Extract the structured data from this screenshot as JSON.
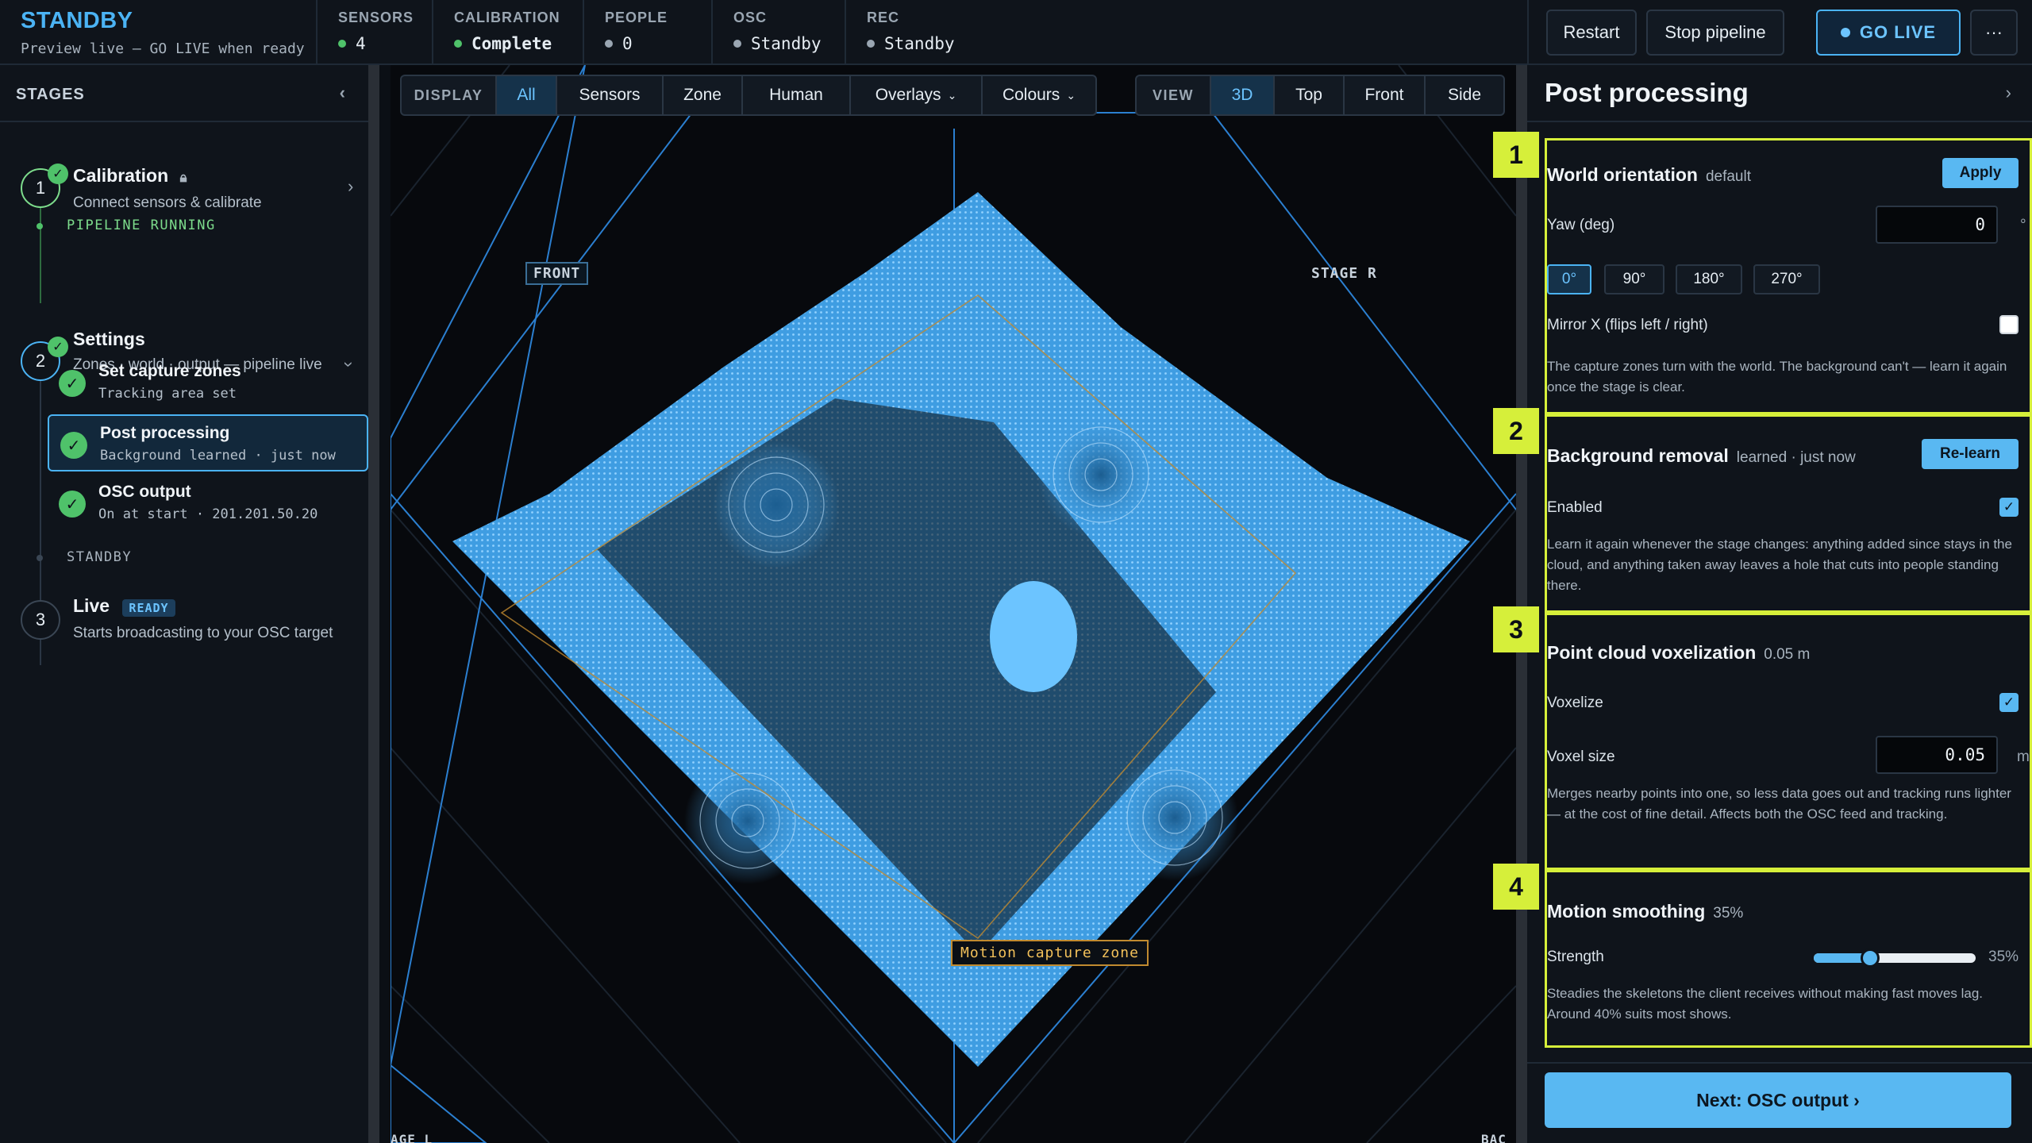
{
  "brand": {
    "title": "STANDBY",
    "subtitle": "Preview live — GO LIVE when ready"
  },
  "stats": [
    {
      "label": "SENSORS",
      "value": "4",
      "dot": "#4fc26a"
    },
    {
      "label": "CALIBRATION",
      "value": "Complete",
      "dot": "#4fc26a"
    },
    {
      "label": "PEOPLE",
      "value": "0",
      "dot": "#9aa6b2"
    },
    {
      "label": "OSC",
      "value": "Standby",
      "dot": "#9aa6b2"
    },
    {
      "label": "REC",
      "value": "Standby",
      "dot": "#9aa6b2"
    }
  ],
  "toolbar": {
    "restart": "Restart",
    "stop": "Stop pipeline",
    "golive": "GO LIVE",
    "more": "···"
  },
  "sidebar": {
    "header": "STAGES",
    "steps": [
      {
        "num": "1",
        "name": "Calibration",
        "desc": "Connect sensors & calibrate"
      },
      {
        "num": "2",
        "name": "Settings",
        "desc": "Zones · world · output — pipeline live"
      },
      {
        "num": "3",
        "name": "Live",
        "badge": "READY",
        "desc": "Starts broadcasting to your OSC target"
      }
    ],
    "pipeline_status": "PIPELINE RUNNING",
    "standby_status": "STANDBY",
    "subitems": [
      {
        "name": "Set capture zones",
        "desc": "Tracking area set"
      },
      {
        "name": "Post processing",
        "desc": "Background learned · just now"
      },
      {
        "name": "OSC output",
        "desc": "On at start · 201.201.50.20"
      }
    ]
  },
  "display": {
    "label": "DISPLAY",
    "options": [
      "All",
      "Sensors",
      "Zone",
      "Human",
      "Overlays",
      "Colours"
    ],
    "selected": "All"
  },
  "view": {
    "label": "VIEW",
    "options": [
      "3D",
      "Top",
      "Front",
      "Side"
    ],
    "selected": "3D"
  },
  "viewport": {
    "front_tag": "FRONT",
    "stage_tag": "STAGE R",
    "zone_label": "Motion capture zone",
    "stage_l": "AGE L",
    "back": "BAC"
  },
  "panel": {
    "title": "Post processing",
    "sections": [
      {
        "num": "1",
        "title": "World orientation",
        "meta": "default",
        "apply": "Apply",
        "yaw_label": "Yaw (deg)",
        "yaw_value": "0",
        "unit": "°",
        "presets": [
          "0°",
          "90°",
          "180°",
          "270°"
        ],
        "mirror_label": "Mirror X (flips left / right)",
        "help": "The capture zones turn with the world. The background can't — learn it again once the stage is clear."
      },
      {
        "num": "2",
        "title": "Background removal",
        "meta": "learned · just now",
        "action": "Re-learn",
        "enabled_label": "Enabled",
        "help": "Learn it again whenever the stage changes: anything added since stays in the cloud, and anything taken away leaves a hole that cuts into people standing there."
      },
      {
        "num": "3",
        "title": "Point cloud voxelization",
        "meta": "0.05 m",
        "voxelize_label": "Voxelize",
        "size_label": "Voxel size",
        "size_value": "0.05",
        "unit": "m",
        "help": "Merges nearby points into one, so less data goes out and tracking runs lighter — at the cost of fine detail. Affects both the OSC feed and tracking."
      },
      {
        "num": "4",
        "title": "Motion smoothing",
        "meta": "35%",
        "strength_label": "Strength",
        "strength_value": "35%",
        "strength": 0.35,
        "help": "Steadies the skeletons the client receives without making fast moves lag. Around 40% suits most shows."
      }
    ],
    "next": "Next: OSC output ›"
  },
  "colors": {
    "accent": "#59b8f2",
    "highlight": "#d6ef3a",
    "ok": "#4fc26a",
    "cloud": "#4aa8ec"
  }
}
